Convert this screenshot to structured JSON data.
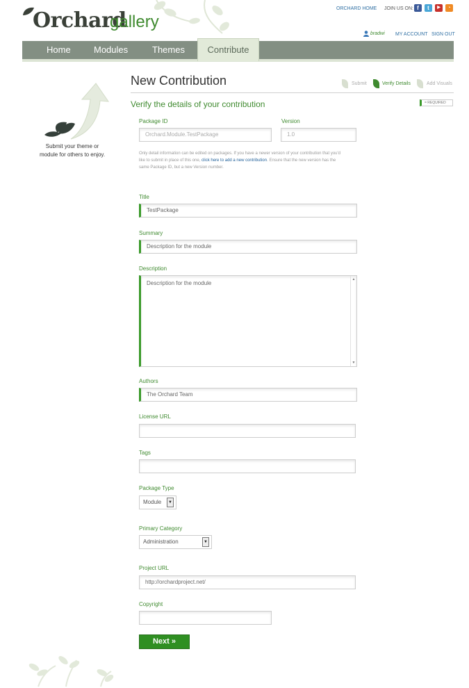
{
  "brand": {
    "name": "Orchard",
    "suffix": "gallery"
  },
  "top_links": {
    "home": "ORCHARD HOME",
    "join": "JOIN US ON:",
    "user": "bradwi",
    "account": "MY ACCOUNT",
    "signout": "SIGN OUT"
  },
  "nav": {
    "items": [
      {
        "label": "Home"
      },
      {
        "label": "Modules"
      },
      {
        "label": "Themes"
      },
      {
        "label": "Contribute"
      }
    ],
    "active": "Contribute"
  },
  "sidebar": {
    "text_line1": "Submit your theme or",
    "text_line2": "module for others to enjoy."
  },
  "page": {
    "title": "New Contribution",
    "section": "Verify the details of your contribution",
    "required": "= REQUIRED",
    "steps": [
      {
        "label": "Submit",
        "active": false
      },
      {
        "label": "Verify Details",
        "active": true
      },
      {
        "label": "Add Visuals",
        "active": false
      }
    ]
  },
  "form": {
    "package_id": {
      "label": "Package ID",
      "value": "Orchard.Module.TestPackage"
    },
    "version": {
      "label": "Version",
      "value": "1.0"
    },
    "help": {
      "before": "Only detail information can be edited on packages. If you have a newer version of your contribution that you'd like to submit in place of this one, ",
      "link": "click here to add a new contribution",
      "after": ". Ensure that the new version has the same Package ID, but a new Version number."
    },
    "title": {
      "label": "Title",
      "value": "TestPackage"
    },
    "summary": {
      "label": "Summary",
      "value": "Description for the module"
    },
    "description": {
      "label": "Description",
      "value": "Description for the module"
    },
    "authors": {
      "label": "Authors",
      "value": "The Orchard Team"
    },
    "license_url": {
      "label": "License URL",
      "value": ""
    },
    "tags": {
      "label": "Tags",
      "value": ""
    },
    "package_type": {
      "label": "Package Type",
      "value": "Module"
    },
    "primary_category": {
      "label": "Primary Category",
      "value": "Administration"
    },
    "project_url": {
      "label": "Project URL",
      "value": "http://orchardproject.net/"
    },
    "copyright": {
      "label": "Copyright",
      "value": ""
    },
    "next_label": "Next »"
  },
  "colors": {
    "accent": "#3f8a2f",
    "nav": "#838f83",
    "button": "#2f8f22",
    "link": "#2f6fa3"
  }
}
